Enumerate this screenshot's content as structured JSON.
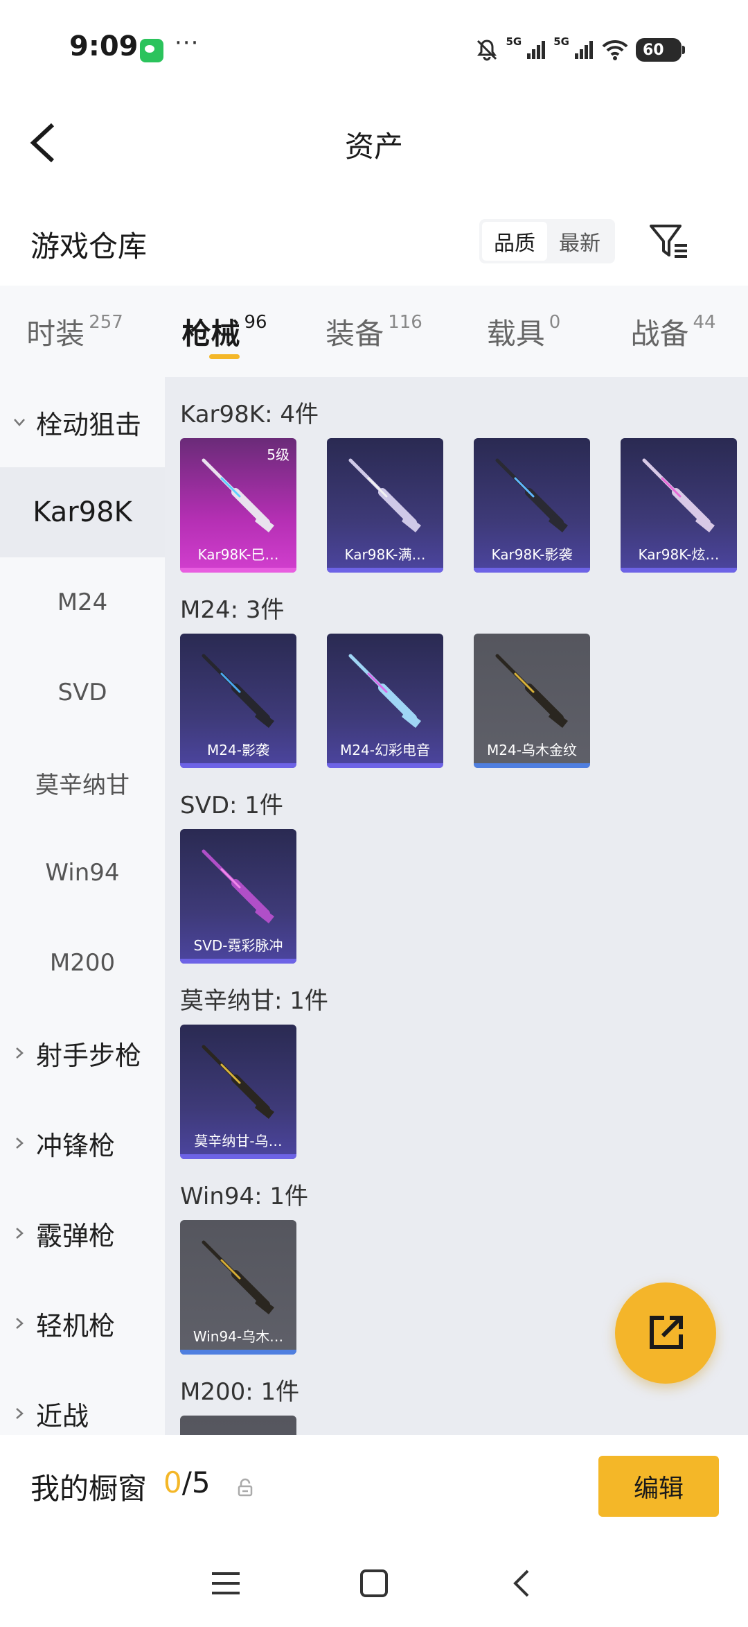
{
  "status_bar": {
    "time": "9:09",
    "dots": "···",
    "net_label_1": "5G",
    "net_label_2": "5G",
    "battery": "60"
  },
  "header": {
    "title": "资产"
  },
  "warehouse": {
    "title": "游戏仓库",
    "sort_options": [
      "品质",
      "最新"
    ],
    "active_sort": "品质"
  },
  "categories": [
    {
      "label": "时装",
      "count": "257"
    },
    {
      "label": "枪械",
      "count": "96",
      "active": true
    },
    {
      "label": "装备",
      "count": "116"
    },
    {
      "label": "载具",
      "count": "0"
    },
    {
      "label": "战备",
      "count": "44"
    }
  ],
  "sidenav": {
    "groups": [
      {
        "label": "栓动狙击",
        "expanded": true,
        "items": [
          "Kar98K",
          "M24",
          "SVD",
          "莫辛纳甘",
          "Win94",
          "M200"
        ],
        "active_item": "Kar98K"
      },
      {
        "label": "射手步枪"
      },
      {
        "label": "冲锋枪"
      },
      {
        "label": "霰弹枪"
      },
      {
        "label": "轻机枪"
      },
      {
        "label": "近战"
      }
    ]
  },
  "sections": [
    {
      "title": "Kar98K: 4件",
      "items": [
        {
          "name": "Kar98K-巳…",
          "level": "5级",
          "rarity": "pink",
          "gun_color": "#e9e2ee",
          "accent": "#5fd0ff"
        },
        {
          "name": "Kar98K-满…",
          "rarity": "purple",
          "gun_color": "#cfc9e8",
          "accent": "#f2f2f2"
        },
        {
          "name": "Kar98K-影袭",
          "rarity": "purple",
          "gun_color": "#2a2a33",
          "accent": "#5fb8ff"
        },
        {
          "name": "Kar98K-炫…",
          "rarity": "purple",
          "gun_color": "#d8c9e6",
          "accent": "#e86ad8"
        }
      ]
    },
    {
      "title": "M24: 3件",
      "items": [
        {
          "name": "M24-影袭",
          "rarity": "purple",
          "gun_color": "#26262e",
          "accent": "#4aa8f0"
        },
        {
          "name": "M24-幻彩电音",
          "rarity": "purple",
          "gun_color": "#9fd6f5",
          "accent": "#d96be8"
        },
        {
          "name": "M24-乌木金纹",
          "rarity": "gray",
          "gun_color": "#2a2620",
          "accent": "#d7b13a"
        }
      ]
    },
    {
      "title": "SVD: 1件",
      "items": [
        {
          "name": "SVD-霓彩脉冲",
          "rarity": "purple",
          "gun_color": "#b04fc8",
          "accent": "#f088ea"
        }
      ]
    },
    {
      "title": "莫辛纳甘: 1件",
      "items": [
        {
          "name": "莫辛纳甘-乌…",
          "rarity": "purple",
          "gun_color": "#2a2620",
          "accent": "#d9b43c"
        }
      ]
    },
    {
      "title": "Win94: 1件",
      "items": [
        {
          "name": "Win94-乌木…",
          "rarity": "gray",
          "gun_color": "#2a2620",
          "accent": "#d4ac36"
        }
      ]
    },
    {
      "title": "M200: 1件",
      "items": [
        {
          "name": "",
          "rarity": "gray",
          "gun_color": "#2a2620",
          "accent": "#d4ac36"
        }
      ]
    }
  ],
  "showcase": {
    "title": "我的橱窗",
    "current": "0",
    "total": "/5",
    "edit_label": "编辑"
  },
  "colors": {
    "accent": "#f4b728",
    "content_bg": "#eaecf1",
    "sidebar_bg": "#f7f8fa"
  }
}
